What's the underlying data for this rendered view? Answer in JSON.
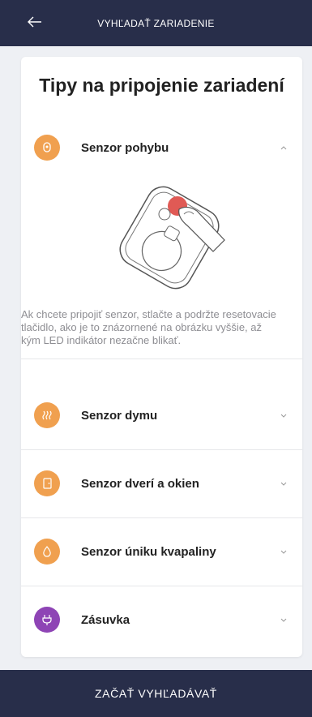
{
  "header": {
    "title": "VYHĽADAŤ ZARIADENIE",
    "back_icon": "arrow-left-icon"
  },
  "card": {
    "title": "Tipy na pripojenie zariadení",
    "items": [
      {
        "label": "Senzor pohybu",
        "icon": "motion-sensor-icon",
        "color": "#f0a04f",
        "expanded": true,
        "description": "Ak chcete pripojiť senzor, stlačte a podržte resetovacie tlačidlo, ako je to znázornené na obrázku vyššie, až kým LED indikátor nezačne blikať."
      },
      {
        "label": "Senzor dymu",
        "icon": "smoke-sensor-icon",
        "color": "#f0a04f",
        "expanded": false
      },
      {
        "label": "Senzor dverí a okien",
        "icon": "door-sensor-icon",
        "color": "#f0a04f",
        "expanded": false
      },
      {
        "label": "Senzor úniku kvapaliny",
        "icon": "water-leak-icon",
        "color": "#f0a04f",
        "expanded": false
      },
      {
        "label": "Zásuvka",
        "icon": "plug-icon",
        "color": "#8e44b5",
        "expanded": false
      }
    ]
  },
  "footer": {
    "button_label": "ZAČAŤ VYHĽADÁVAŤ"
  },
  "colors": {
    "navy": "#282e4a",
    "orange": "#f0a04f",
    "purple": "#8e44b5",
    "reset_button": "#e05a55"
  }
}
